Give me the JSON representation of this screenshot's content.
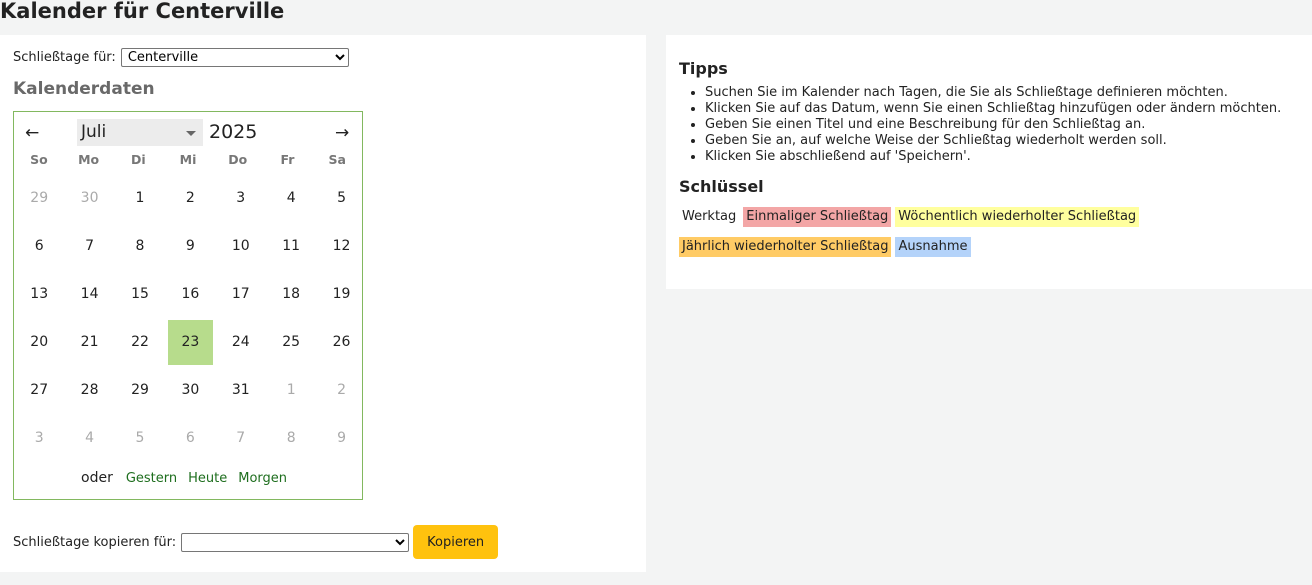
{
  "page": {
    "title": "Kalender für Centerville"
  },
  "closed_for": {
    "label": "Schließtage für:",
    "selected": "Centerville"
  },
  "calendar": {
    "heading": "Kalenderdaten",
    "prev_arrow": "←",
    "next_arrow": "→",
    "month": "Juli",
    "year": "2025",
    "weekdays": [
      "So",
      "Mo",
      "Di",
      "Mi",
      "Do",
      "Fr",
      "Sa"
    ],
    "weeks": [
      [
        [
          "29",
          "other"
        ],
        [
          "30",
          "other"
        ],
        [
          "1",
          ""
        ],
        [
          "2",
          ""
        ],
        [
          "3",
          ""
        ],
        [
          "4",
          ""
        ],
        [
          "5",
          ""
        ]
      ],
      [
        [
          "6",
          ""
        ],
        [
          "7",
          ""
        ],
        [
          "8",
          ""
        ],
        [
          "9",
          ""
        ],
        [
          "10",
          ""
        ],
        [
          "11",
          ""
        ],
        [
          "12",
          ""
        ]
      ],
      [
        [
          "13",
          ""
        ],
        [
          "14",
          ""
        ],
        [
          "15",
          ""
        ],
        [
          "16",
          ""
        ],
        [
          "17",
          ""
        ],
        [
          "18",
          ""
        ],
        [
          "19",
          ""
        ]
      ],
      [
        [
          "20",
          ""
        ],
        [
          "21",
          ""
        ],
        [
          "22",
          ""
        ],
        [
          "23",
          "today"
        ],
        [
          "24",
          ""
        ],
        [
          "25",
          ""
        ],
        [
          "26",
          ""
        ]
      ],
      [
        [
          "27",
          ""
        ],
        [
          "28",
          ""
        ],
        [
          "29",
          ""
        ],
        [
          "30",
          ""
        ],
        [
          "31",
          ""
        ],
        [
          "1",
          "other"
        ],
        [
          "2",
          "other"
        ]
      ],
      [
        [
          "3",
          "other"
        ],
        [
          "4",
          "other"
        ],
        [
          "5",
          "other"
        ],
        [
          "6",
          "other"
        ],
        [
          "7",
          "other"
        ],
        [
          "8",
          "other"
        ],
        [
          "9",
          "other"
        ]
      ]
    ],
    "or_label": "oder",
    "shortcuts": [
      "Gestern",
      "Heute",
      "Morgen"
    ]
  },
  "copy": {
    "label": "Schließtage kopieren für:",
    "selected": "",
    "button_label": "Kopieren"
  },
  "tips": {
    "heading": "Tipps",
    "items": [
      "Suchen Sie im Kalender nach Tagen, die Sie als Schließtage definieren möchten.",
      "Klicken Sie auf das Datum, wenn Sie einen Schließtag hinzufügen oder ändern möchten.",
      "Geben Sie einen Titel und eine Beschreibung für den Schließtag an.",
      "Geben Sie an, auf welche Weise der Schließtag wiederholt werden soll.",
      "Klicken Sie abschließend auf 'Speichern'."
    ]
  },
  "key": {
    "heading": "Schlüssel",
    "workday": "Werktag",
    "single": "Einmaliger Schließtag",
    "weekly": "Wöchentlich wiederholter Schließtag",
    "yearly": "Jährlich wiederholter Schließtag",
    "exception": "Ausnahme"
  },
  "colors": {
    "accent_yellow": "#ffc20e",
    "today_green": "#b7dc8c",
    "single_closed": "#f3a6a6",
    "weekly_closed": "#ffff9e",
    "yearly_closed": "#ffcb65",
    "exception": "#b4d3fa"
  }
}
